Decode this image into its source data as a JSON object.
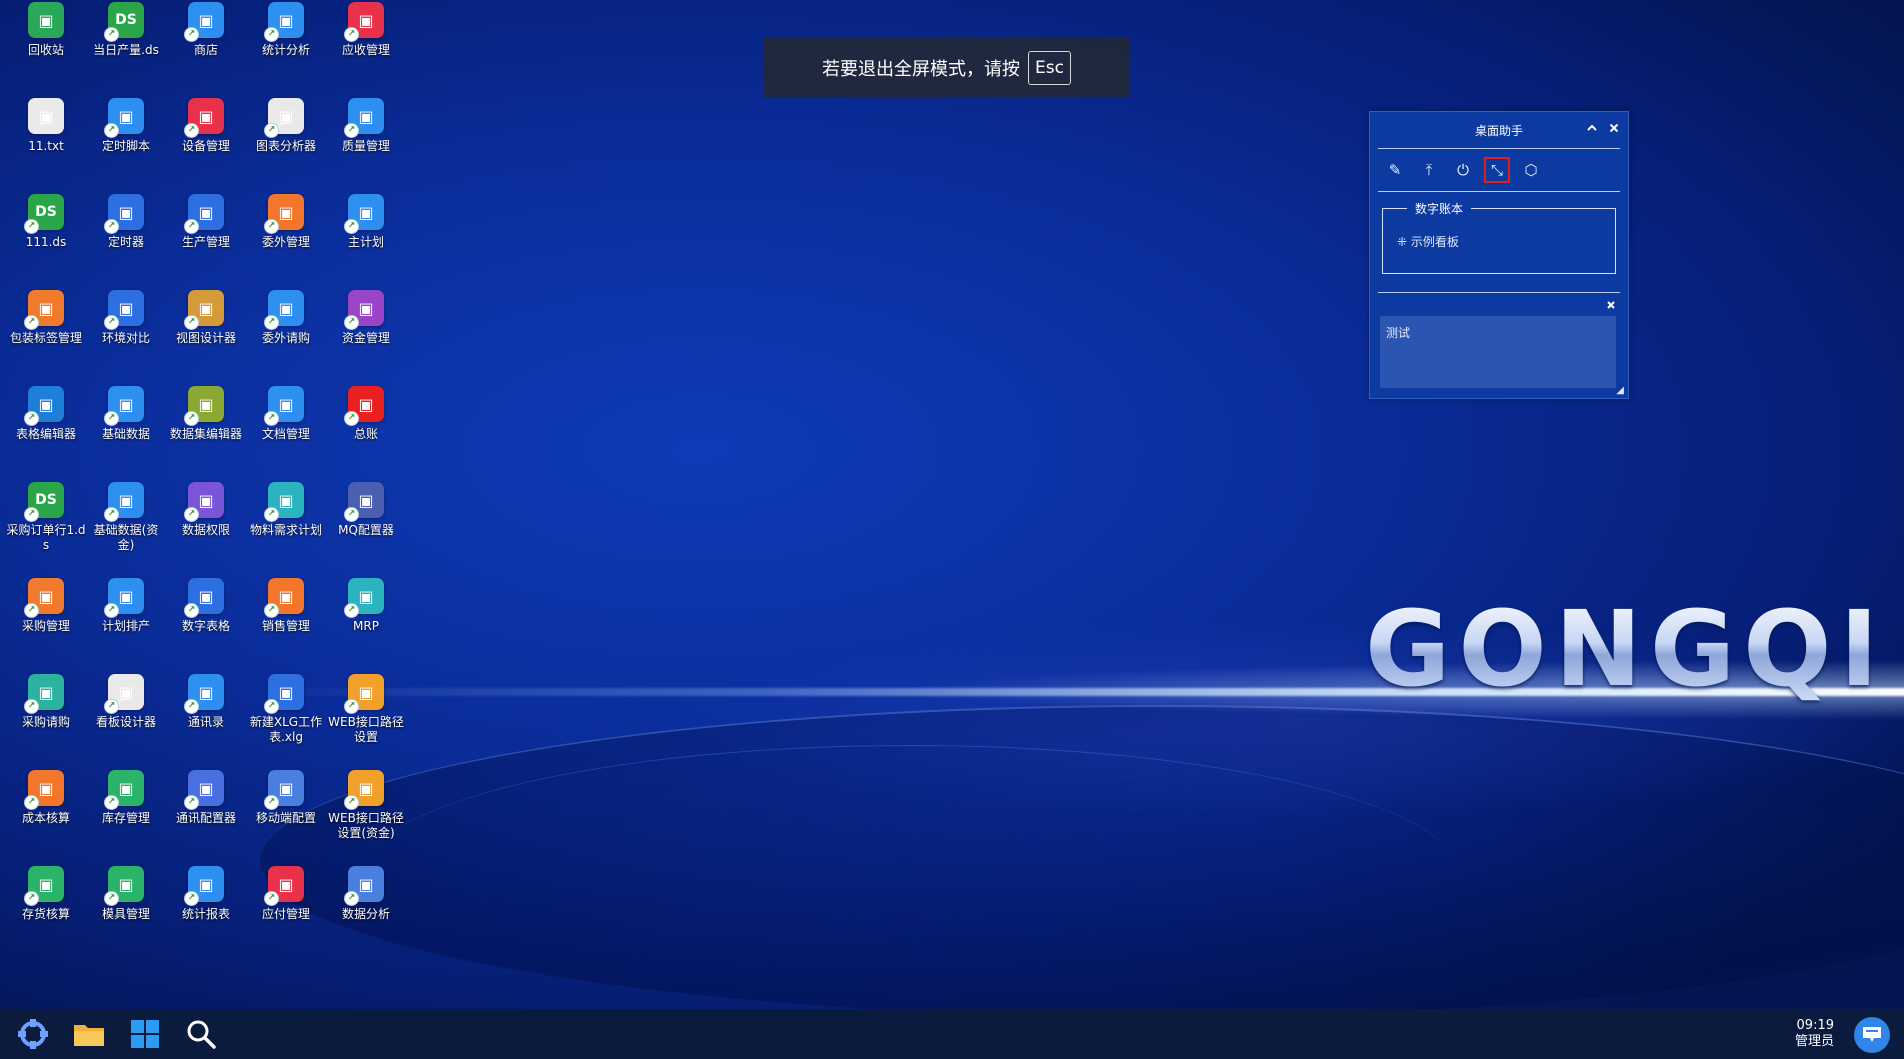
{
  "desktop_icons": [
    {
      "label": "回收站",
      "icon": "recycle-bin-icon",
      "color": "#29a85a"
    },
    {
      "label": "11.txt",
      "icon": "text-file-icon",
      "color": "#eaeaea"
    },
    {
      "label": "111.ds",
      "icon": "ds-file-icon",
      "color": "#2aa648",
      "short": "DS"
    },
    {
      "label": "包装标签管理",
      "icon": "package-label-icon",
      "color": "#f07b2c"
    },
    {
      "label": "表格编辑器",
      "icon": "table-editor-icon",
      "color": "#1d7fd8"
    },
    {
      "label": "采购订单行1.ds",
      "icon": "ds-file-icon",
      "color": "#2aa648",
      "short": "DS"
    },
    {
      "label": "采购管理",
      "icon": "purchase-management-icon",
      "color": "#f27a2e"
    },
    {
      "label": "采购请购",
      "icon": "purchase-request-icon",
      "color": "#2bb3a0"
    },
    {
      "label": "成本核算",
      "icon": "cost-accounting-icon",
      "color": "#f2762c"
    },
    {
      "label": "存货核算",
      "icon": "inventory-accounting-icon",
      "color": "#2bb36a"
    },
    {
      "label": "当日产量.ds",
      "icon": "ds-file-icon",
      "color": "#2aa648",
      "short": "DS"
    },
    {
      "label": "定时脚本",
      "icon": "timed-script-icon",
      "color": "#2d8ff0"
    },
    {
      "label": "定时器",
      "icon": "timer-icon",
      "color": "#2d6fe0"
    },
    {
      "label": "环境对比",
      "icon": "environment-compare-icon",
      "color": "#2d6fe0"
    },
    {
      "label": "基础数据",
      "icon": "basic-data-icon",
      "color": "#2d8ff0"
    },
    {
      "label": "基础数据(资金)",
      "icon": "basic-data-fund-icon",
      "color": "#2d8ff0"
    },
    {
      "label": "计划排产",
      "icon": "production-plan-icon",
      "color": "#2d8ff0"
    },
    {
      "label": "看板设计器",
      "icon": "board-designer-icon",
      "color": "#e9e9e9"
    },
    {
      "label": "库存管理",
      "icon": "stock-management-icon",
      "color": "#2bb36a"
    },
    {
      "label": "模具管理",
      "icon": "mould-management-icon",
      "color": "#2bb36a"
    },
    {
      "label": "商店",
      "icon": "store-icon",
      "color": "#2d8ff0"
    },
    {
      "label": "设备管理",
      "icon": "equipment-management-icon",
      "color": "#e8324c"
    },
    {
      "label": "生产管理",
      "icon": "production-management-icon",
      "color": "#2d6fe0"
    },
    {
      "label": "视图设计器",
      "icon": "view-designer-icon",
      "color": "#d59a3a"
    },
    {
      "label": "数据集编辑器",
      "icon": "dataset-editor-icon",
      "color": "#8aa832"
    },
    {
      "label": "数据权限",
      "icon": "data-permission-icon",
      "color": "#7a55d8"
    },
    {
      "label": "数字表格",
      "icon": "digital-sheet-icon",
      "color": "#2d6fe0"
    },
    {
      "label": "通讯录",
      "icon": "contacts-icon",
      "color": "#2d8ff0"
    },
    {
      "label": "通讯配置器",
      "icon": "comm-config-icon",
      "color": "#4a6fe0"
    },
    {
      "label": "统计报表",
      "icon": "statistics-report-icon",
      "color": "#2d8ff0"
    },
    {
      "label": "统计分析",
      "icon": "statistics-analysis-icon",
      "color": "#2d8ff0"
    },
    {
      "label": "图表分析器",
      "icon": "chart-analyzer-icon",
      "color": "#e9e9e9"
    },
    {
      "label": "委外管理",
      "icon": "outsourcing-management-icon",
      "color": "#f2762c"
    },
    {
      "label": "委外请购",
      "icon": "outsourcing-request-icon",
      "color": "#2d8ff0"
    },
    {
      "label": "文档管理",
      "icon": "document-management-icon",
      "color": "#2d8ff0"
    },
    {
      "label": "物料需求计划",
      "icon": "material-plan-icon",
      "color": "#2bb3c0"
    },
    {
      "label": "销售管理",
      "icon": "sales-management-icon",
      "color": "#f2762c"
    },
    {
      "label": "新建XLG工作表.xlg",
      "icon": "xlg-sheet-icon",
      "color": "#2d6fe0"
    },
    {
      "label": "移动端配置",
      "icon": "mobile-config-icon",
      "color": "#4a7fe0"
    },
    {
      "label": "应付管理",
      "icon": "payable-management-icon",
      "color": "#e8324c"
    },
    {
      "label": "应收管理",
      "icon": "receivable-management-icon",
      "color": "#e8324c"
    },
    {
      "label": "质量管理",
      "icon": "quality-management-icon",
      "color": "#2d8ff0"
    },
    {
      "label": "主计划",
      "icon": "master-plan-icon",
      "color": "#2d8ff0"
    },
    {
      "label": "资金管理",
      "icon": "fund-management-icon",
      "color": "#9a45c8"
    },
    {
      "label": "总账",
      "icon": "general-ledger-icon",
      "color": "#e82020"
    },
    {
      "label": "MQ配置器",
      "icon": "mq-config-icon",
      "color": "#4a5fb0"
    },
    {
      "label": "MRP",
      "icon": "mrp-icon",
      "color": "#2bb3c0"
    },
    {
      "label": "WEB接口路径设置",
      "icon": "web-api-path-icon",
      "color": "#f2a02c"
    },
    {
      "label": "WEB接口路径设置(资金)",
      "icon": "web-api-path-fund-icon",
      "color": "#f2a02c"
    },
    {
      "label": "数据分析",
      "icon": "data-analysis-icon",
      "color": "#4a7fe0"
    }
  ],
  "fullscreen_tip": {
    "text": "若要退出全屏模式，请按",
    "key": "Esc"
  },
  "assistant": {
    "title": "桌面助手",
    "collapse_icon": "chevron-up-icon",
    "close_icon": "close-icon",
    "tools": [
      {
        "icon": "edit-icon",
        "glyph": "✎"
      },
      {
        "icon": "pin-top-icon",
        "glyph": "⤒"
      },
      {
        "icon": "power-icon",
        "glyph": "⏻"
      },
      {
        "icon": "shrink-icon",
        "glyph": "⤡",
        "active": true
      },
      {
        "icon": "cube-icon",
        "glyph": "⬡"
      }
    ],
    "group_title": "数字账本",
    "group_item": "示例看板",
    "note_text": "测试"
  },
  "brand_text": "GONGQI",
  "taskbar": {
    "buttons": [
      {
        "icon": "start-menu-icon"
      },
      {
        "icon": "file-explorer-icon"
      },
      {
        "icon": "windows-icon"
      },
      {
        "icon": "search-icon"
      }
    ],
    "time": "09:19",
    "user": "管理员",
    "notify_icon": "notification-icon"
  },
  "colors": {
    "desktop_bg": "#0a2c98",
    "taskbar_bg": "#0b1b3d",
    "assistant_bg": "#0d3aa0",
    "active_tool_border": "#e02020"
  }
}
